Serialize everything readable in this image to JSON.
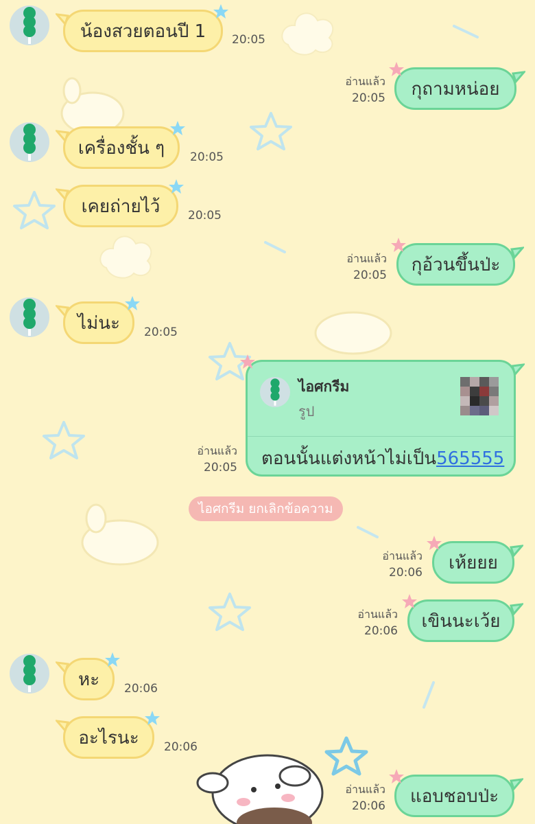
{
  "messages": [
    {
      "id": "m1",
      "side": "in",
      "text": "น้องสวยตอนปี 1",
      "time": "20:05"
    },
    {
      "id": "m2",
      "side": "out",
      "text": "กุถามหน่อย",
      "time": "20:05",
      "read": "อ่านแล้ว"
    },
    {
      "id": "m3",
      "side": "in",
      "text": "เครื่องชั้น ๆ",
      "time": "20:05"
    },
    {
      "id": "m4",
      "side": "in",
      "text": "เคยถ่ายไว้",
      "time": "20:05"
    },
    {
      "id": "m5",
      "side": "out",
      "text": "กุอ้วนขึ้นป่ะ",
      "time": "20:05",
      "read": "อ่านแล้ว"
    },
    {
      "id": "m6",
      "side": "in",
      "text": "ไม่นะ",
      "time": "20:05"
    },
    {
      "id": "m8",
      "side": "out",
      "text": "เห้ยยย",
      "time": "20:06",
      "read": "อ่านแล้ว"
    },
    {
      "id": "m9",
      "side": "out",
      "text": "เขินนะเว้ย",
      "time": "20:06",
      "read": "อ่านแล้ว"
    },
    {
      "id": "m10",
      "side": "in",
      "text": "หะ",
      "time": "20:06"
    },
    {
      "id": "m11",
      "side": "in",
      "text": "อะไรนะ",
      "time": "20:06"
    },
    {
      "id": "m12",
      "side": "out",
      "text": "แอบชอบป่ะ",
      "time": "20:06",
      "read": "อ่านแล้ว"
    }
  ],
  "reply": {
    "quoted_name": "ไอศกรีม",
    "quoted_type": "รูป",
    "text": "ตอนนั้นแต่งหน้าไม่เป็น",
    "link": "565555",
    "time": "20:05",
    "read": "อ่านแล้ว"
  },
  "system_notice": "ไอศกรีม ยกเลิกข้อความ",
  "colors": {
    "background": "#fdf4c9",
    "incoming_bubble": "#fdf0a8",
    "outgoing_bubble": "#a8efc8",
    "unsend_notice": "#f5b8b3",
    "link": "#2f6fe0",
    "avatar_icon": "#1fa86b"
  },
  "icons": {
    "avatar": "green-dango-icon",
    "incoming_decoration": "blue-star-icon",
    "outgoing_decoration": "pink-star-icon"
  }
}
